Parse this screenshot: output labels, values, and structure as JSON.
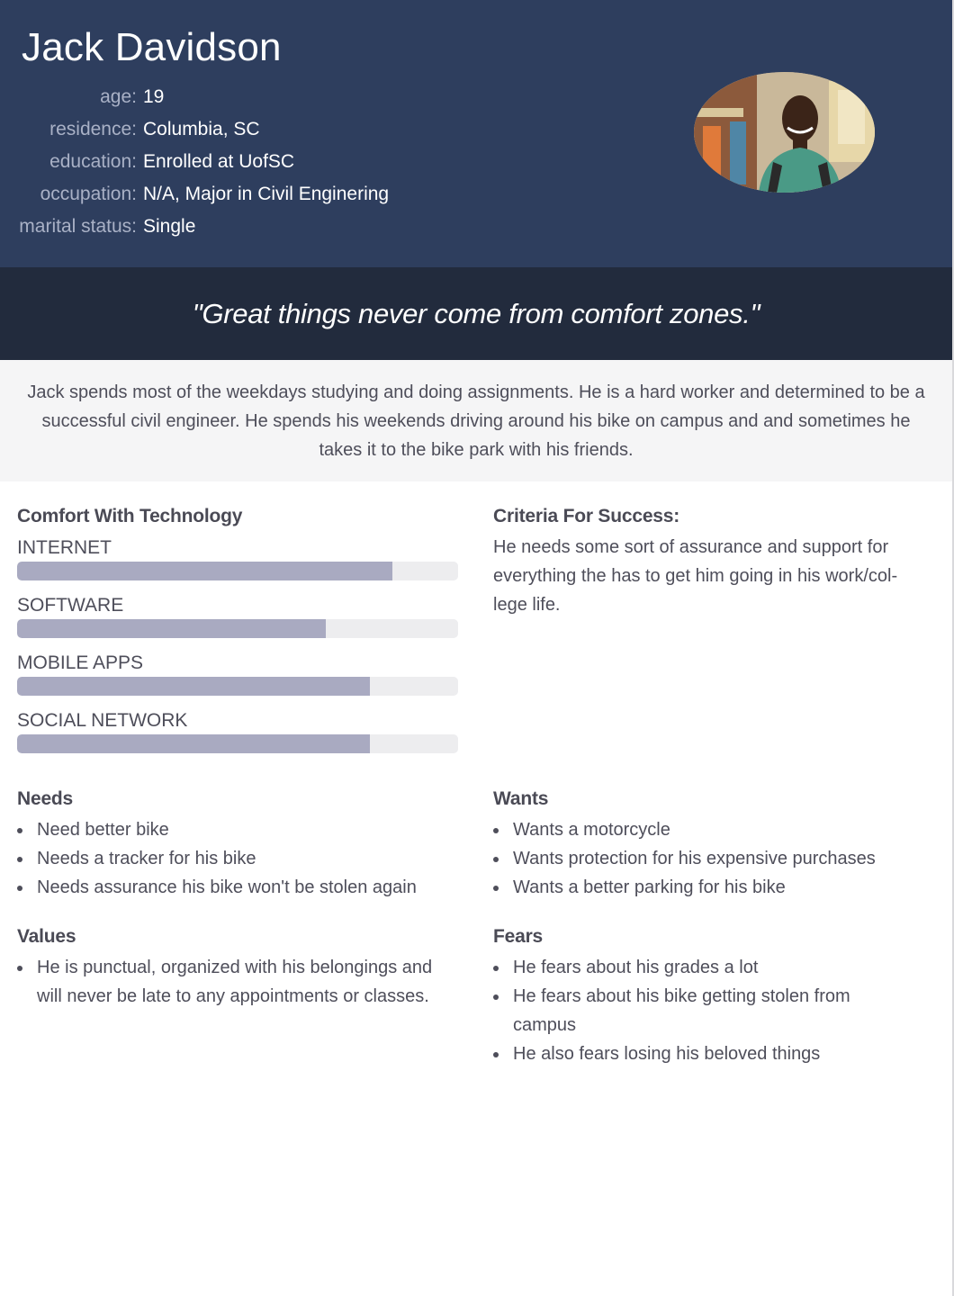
{
  "persona": {
    "name": "Jack Davidson",
    "details": [
      {
        "label": "age:",
        "value": "19"
      },
      {
        "label": "residence:",
        "value": "Columbia, SC"
      },
      {
        "label": "education:",
        "value": "Enrolled at UofSC"
      },
      {
        "label": "occupation:",
        "value": "N/A, Major in Civil Enginering"
      },
      {
        "label": "marital status:",
        "value": "Single"
      }
    ],
    "photo": "portrait-photo"
  },
  "quote": "\"Great things never come from comfort zones.\"",
  "bio": "Jack spends most of the weekdays studying and doing assignments. He is a hard worker and determined to be a successful civil engineer. He spends his weekends driving around his bike on campus and and sometimes he takes it to the bike park with his friends.",
  "technology": {
    "title": "Comfort With Technology",
    "items": [
      {
        "label": "INTERNET",
        "level": 0.85
      },
      {
        "label": "SOFTWARE",
        "level": 0.7
      },
      {
        "label": "MOBILE APPS",
        "level": 0.8
      },
      {
        "label": "SOCIAL NETWORK",
        "level": 0.8
      }
    ]
  },
  "criteria": {
    "title": "Criteria For Success:",
    "lines": [
      "He needs some sort of assurance and support for",
      "everything the has to get him going in his work/col-",
      "lege life."
    ]
  },
  "needs": {
    "title": "Needs",
    "items": [
      "Need better bike",
      "Needs a tracker for his bike",
      "Needs assurance his bike won't be stolen again"
    ]
  },
  "wants": {
    "title": "Wants",
    "items": [
      "Wants a motorcycle",
      "Wants protection for his expensive purchases",
      "Wants a better parking for his bike"
    ]
  },
  "values": {
    "title": "Values",
    "items": [
      "He is punctual, organized with his belongings and will never be late to any appointments or classes."
    ]
  },
  "fears": {
    "title": "Fears",
    "items": [
      "He fears about his grades a lot",
      "He fears about his bike getting stolen from campus",
      "He also fears losing his beloved things"
    ]
  },
  "colors": {
    "header": "#2e3e5e",
    "quote_band": "#222b3d",
    "bio_band": "#f5f5f6",
    "bar_fill": "#a9aac1",
    "bar_track": "#ededef"
  }
}
